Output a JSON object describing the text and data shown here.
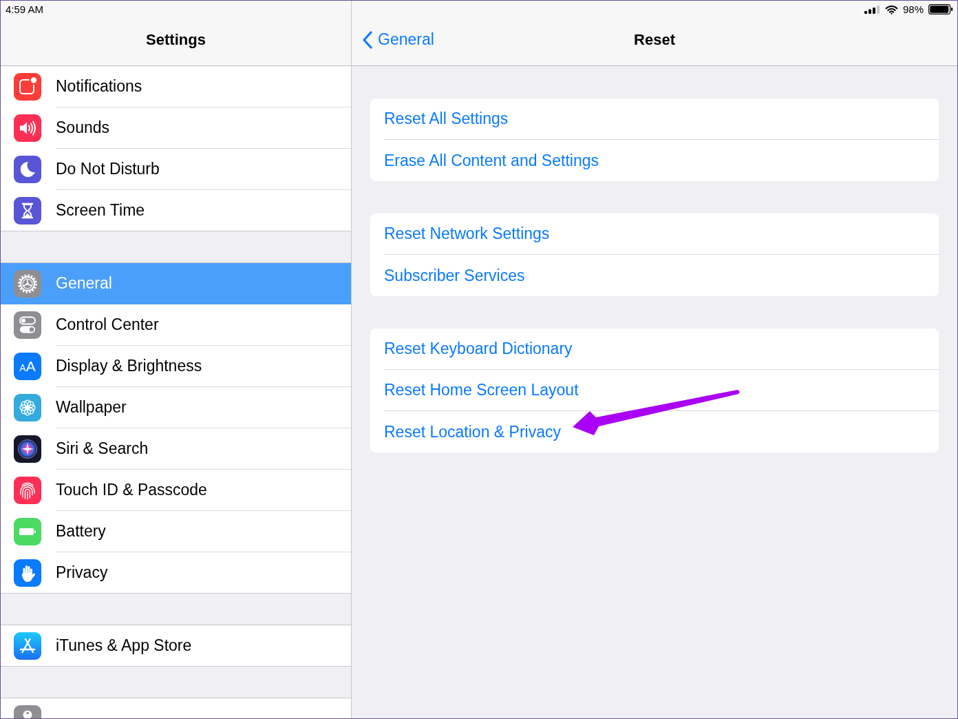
{
  "status_bar": {
    "time": "4:59 AM",
    "battery": "98%"
  },
  "sidebar": {
    "title": "Settings",
    "groups": [
      {
        "items": [
          {
            "label": "Notifications",
            "selected": false
          },
          {
            "label": "Sounds",
            "selected": false
          },
          {
            "label": "Do Not Disturb",
            "selected": false
          },
          {
            "label": "Screen Time",
            "selected": false
          }
        ]
      },
      {
        "items": [
          {
            "label": "General",
            "selected": true
          },
          {
            "label": "Control Center",
            "selected": false
          },
          {
            "label": "Display & Brightness",
            "selected": false,
            "icon_text": "AA"
          },
          {
            "label": "Wallpaper",
            "selected": false
          },
          {
            "label": "Siri & Search",
            "selected": false
          },
          {
            "label": "Touch ID & Passcode",
            "selected": false
          },
          {
            "label": "Battery",
            "selected": false
          },
          {
            "label": "Privacy",
            "selected": false
          }
        ]
      },
      {
        "items": [
          {
            "label": "iTunes & App Store",
            "selected": false
          }
        ]
      },
      {
        "items": [
          {
            "selected": false
          }
        ]
      }
    ]
  },
  "detail": {
    "back": "General",
    "title": "Reset",
    "groups": [
      {
        "items": [
          {
            "label": "Reset All Settings",
            "annotated": false
          },
          {
            "label": "Erase All Content and Settings",
            "annotated": false
          }
        ]
      },
      {
        "items": [
          {
            "label": "Reset Network Settings",
            "annotated": false
          },
          {
            "label": "Subscriber Services",
            "annotated": false
          }
        ]
      },
      {
        "items": [
          {
            "label": "Reset Keyboard Dictionary",
            "annotated": false
          },
          {
            "label": "Reset Home Screen Layout",
            "annotated": false
          },
          {
            "label": "Reset Location & Privacy",
            "annotated": true
          }
        ]
      }
    ]
  }
}
